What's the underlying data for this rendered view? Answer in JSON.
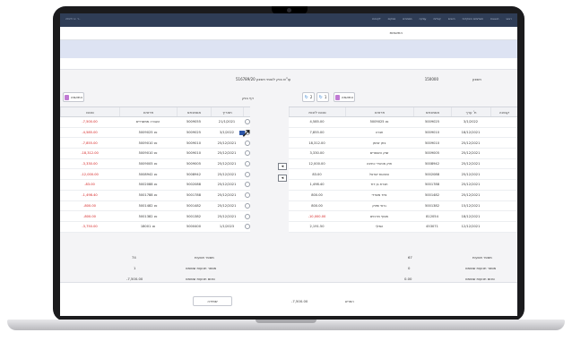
{
  "topbar": {
    "window_title": "ב' יוני 2023 ·",
    "menu": [
      "ראשי",
      "הוצאות",
      "תשלומים והפקדות",
      "חיובים",
      "קבלות",
      "עסקה",
      "מסמכים",
      "ספקים",
      "לקוחות"
    ]
  },
  "header": {
    "page_title": "התאמות"
  },
  "info_row": {
    "right_label": "חשבון",
    "right_value": "150000",
    "center_text": "עו\"ש בנק לאומי חשבון 516789/20",
    "left_label": "דף בנק"
  },
  "left_toolbar": {
    "new_match_button": "התאמה"
  },
  "right_toolbar": {
    "new_match_button": "התאמה",
    "counter_a": "1",
    "counter_b": "2"
  },
  "left_table": {
    "columns": [
      "",
      "תאריך",
      "אסמכתא",
      "פרטים",
      "סכום"
    ],
    "rows": [
      {
        "date": "21/1/2021",
        "ref": "5009055",
        "details": "העברה ממשרדים",
        "amount": "-7,500.00"
      },
      {
        "date": "3/1/2022",
        "ref": "5009025",
        "details": "פנ 5009025",
        "amount": "-4,585.00"
      },
      {
        "date": "25/12/2021",
        "ref": "5009010",
        "details": "פנ 5009010",
        "amount": "-7,855.00"
      },
      {
        "date": "25/12/2021",
        "ref": "5009010",
        "details": "פנ 5009010",
        "amount": "-18,312.00"
      },
      {
        "date": "25/12/2021",
        "ref": "5009005",
        "details": "פנ 5009005",
        "amount": "-3,330.00"
      },
      {
        "date": "25/12/2021",
        "ref": "5008942",
        "details": "פנ 5008942",
        "amount": "-12,000.00"
      },
      {
        "date": "25/12/2021",
        "ref": "5002088",
        "details": "פנ 5002088",
        "amount": "-83.00"
      },
      {
        "date": "25/12/2021",
        "ref": "5001788",
        "details": "פנ 5001788",
        "amount": "-1,498.40"
      },
      {
        "date": "25/12/2021",
        "ref": "5001482",
        "details": "פנ 5001482",
        "amount": "-800.00"
      },
      {
        "date": "25/12/2021",
        "ref": "5001382",
        "details": "פנ 5001382",
        "amount": "-800.00"
      },
      {
        "date": "1/1/2023",
        "ref": "5000400",
        "details": "פנ 18001",
        "amount": "-3,750.00"
      }
    ]
  },
  "right_table": {
    "columns": [
      "קבוצה",
      "ת' ערך",
      "אסמכתא",
      "פרטים",
      "סכום לזכות"
    ],
    "rows": [
      {
        "date": "3/1/2022",
        "ref": "5009025",
        "details": "פנ 5009025",
        "amount": "4,585.00"
      },
      {
        "date": "18/12/2021",
        "ref": "5009010",
        "details": "חברה",
        "amount": "7,855.00"
      },
      {
        "date": "25/12/2021",
        "ref": "5009010",
        "details": "בזק שיווק",
        "amount": "18,312.00"
      },
      {
        "date": "25/12/2021",
        "ref": "5009005",
        "details": "שוק השופרים",
        "amount": "3,330.00"
      },
      {
        "date": "25/12/2021",
        "ref": "5008942",
        "details": "חוק מכשירי כתיבה",
        "amount": "12,000.00"
      },
      {
        "date": "25/12/2021",
        "ref": "5002088",
        "details": "הוצאות ישראל",
        "amount": "83.00"
      },
      {
        "date": "25/12/2021",
        "ref": "5001788",
        "details": "חברת בן דוד",
        "amount": "1,498.40"
      },
      {
        "date": "25/12/2021",
        "ref": "5001482",
        "details": "ציוד משרדי",
        "amount": "800.00"
      },
      {
        "date": "15/12/2021",
        "ref": "5001382",
        "details": "גרפי שיווק",
        "amount": "800.00"
      },
      {
        "date": "18/12/2021",
        "ref": "812054",
        "details": "מסוף מרכזים",
        "amount": "-10,000.00"
      },
      {
        "date": "12/12/2021",
        "ref": "453071",
        "details": "המלך",
        "amount": "2,191.50"
      }
    ]
  },
  "summary": {
    "left_labels": [
      "מספר תנועות",
      "מספר תנועות שסומנו",
      "סכום תנועות שסומנו"
    ],
    "left_values": [
      "74",
      "1",
      "-7,500.00"
    ],
    "right_labels": [
      "מספר תנועות",
      "מספר תנועות שסומנו",
      "סכום תנועות שסומנו"
    ],
    "right_values": [
      "67",
      "0",
      "0.00"
    ],
    "diff_label": "הפרש",
    "diff_value": "-7,500.00"
  },
  "actions": {
    "save_button": "שמירה"
  }
}
